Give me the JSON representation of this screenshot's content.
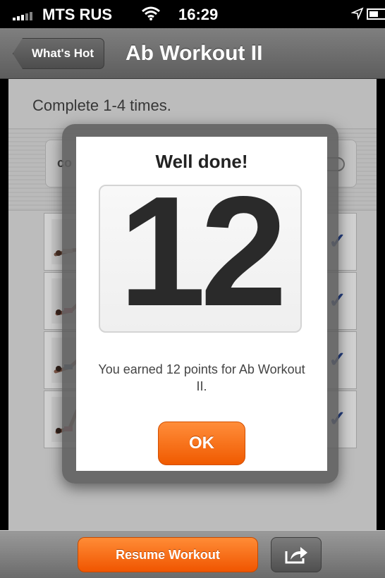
{
  "status_bar": {
    "carrier": "MTS RUS",
    "time": "16:29",
    "icons": [
      "signal-icon",
      "wifi-icon",
      "location-icon",
      "battery-icon"
    ]
  },
  "nav": {
    "back_label": "What's Hot",
    "title": "Ab Workout II"
  },
  "content": {
    "subtitle": "Complete 1-4 times.",
    "card_label_fragment": "co",
    "exercises": [
      {
        "thumb": "exercise-thumbnail",
        "completed": true
      },
      {
        "thumb": "exercise-thumbnail",
        "completed": true
      },
      {
        "thumb": "exercise-thumbnail",
        "completed": true
      },
      {
        "thumb": "exercise-thumbnail",
        "completed": true
      }
    ]
  },
  "modal": {
    "title": "Well done!",
    "score": "12",
    "message": "You earned 12 points for Ab Workout II.",
    "ok_label": "OK"
  },
  "toolbar": {
    "resume_label": "Resume Workout",
    "share_icon": "share-icon"
  },
  "colors": {
    "accent_orange": "#f26a0f",
    "check_blue": "#2e4e9e",
    "nav_gray": "#6e6e6e"
  }
}
